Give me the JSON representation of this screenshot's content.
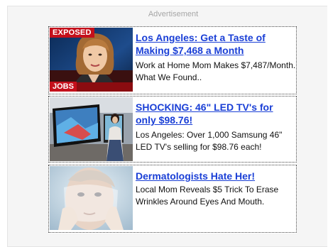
{
  "header": {
    "advertisement_label": "Advertisement"
  },
  "ads": [
    {
      "title": "Los Angeles: Get a Taste of Making $7,468 a Month",
      "description": "Work at Home Mom Makes $7,487/Month. What We Found..",
      "badge_top": "EXPOSED",
      "badge_bottom": "JOBS"
    },
    {
      "title": "SHOCKING: 46\" LED TV's for only $98.76!",
      "description": "Los Angeles: Over 1,000 Samsung 46\" LED TV's selling for $98.76 each!"
    },
    {
      "title": "Dermatologists Hate Her!",
      "description": "Local Mom Reveals $5 Trick To Erase Wrinkles Around Eyes And Mouth."
    }
  ],
  "colors": {
    "link": "#1a3fd6",
    "badge": "#c4101b",
    "panel_bg": "#f5f5f5"
  }
}
